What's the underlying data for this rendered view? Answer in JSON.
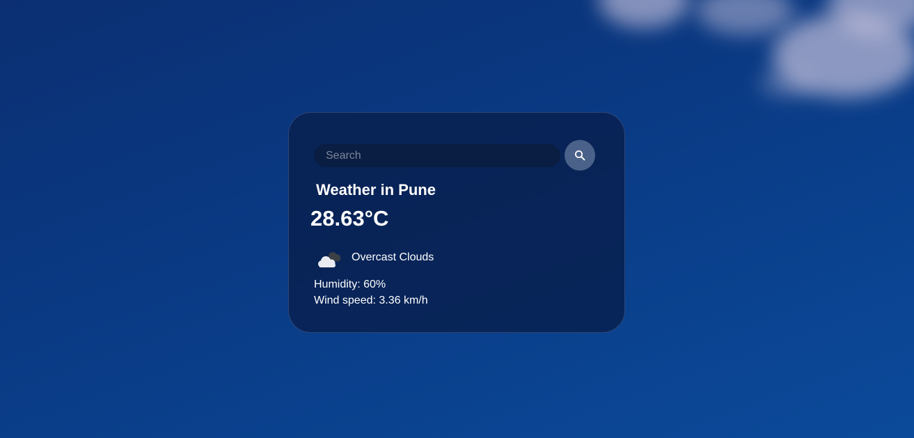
{
  "search": {
    "placeholder": "Search",
    "value": "",
    "button_icon": "search-icon"
  },
  "weather": {
    "title": "Weather in Pune",
    "temperature": "28.63°C",
    "icon": "overcast-clouds-icon",
    "description": "Overcast Clouds",
    "humidity": "Humidity: 60%",
    "wind_speed": "Wind speed: 3.36 km/h"
  },
  "colors": {
    "background": "#0b3a84",
    "card": "#0a1f4c",
    "search_field": "#0a1d42",
    "search_button": "#4a6189",
    "text": "#ffffff"
  }
}
